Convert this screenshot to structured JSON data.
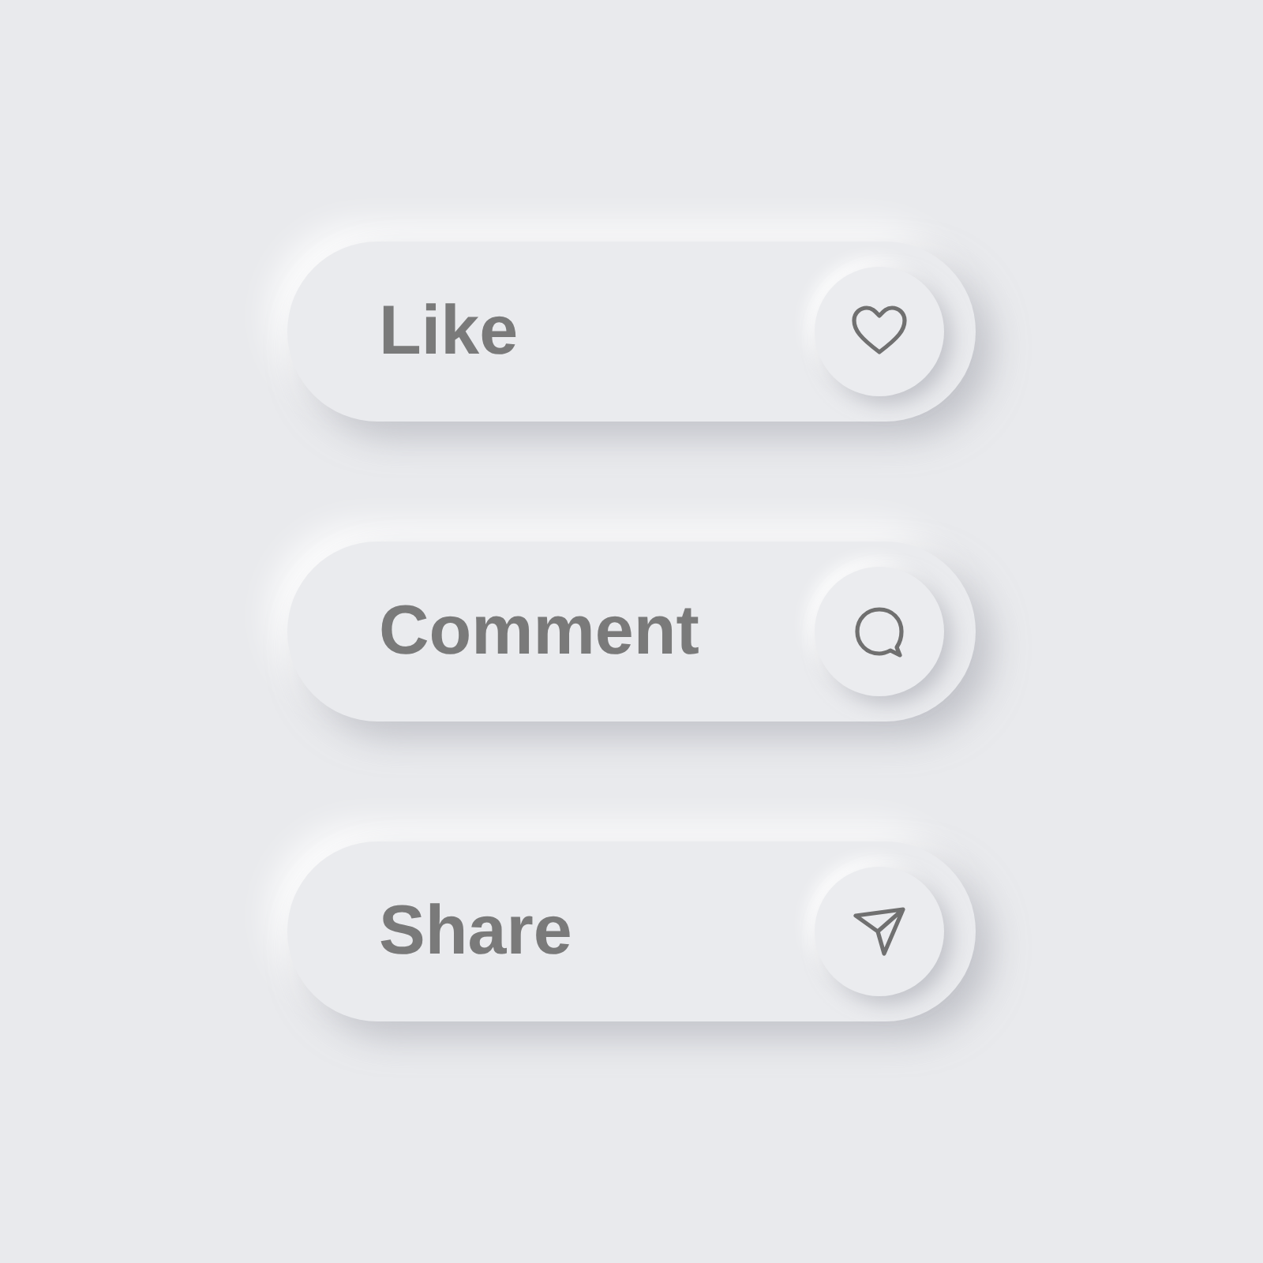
{
  "buttons": [
    {
      "label": "Like",
      "kind": "heart"
    },
    {
      "label": "Comment",
      "kind": "bubble"
    },
    {
      "label": "Share",
      "kind": "send"
    }
  ]
}
